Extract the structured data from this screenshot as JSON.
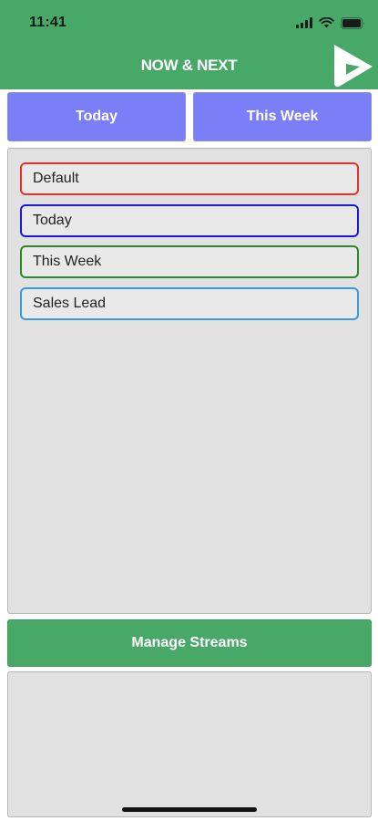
{
  "status_bar": {
    "time": "11:41"
  },
  "header": {
    "title": "NOW & NEXT",
    "logo_icon": "play-arrow-logo-icon"
  },
  "tabs": [
    {
      "label": "Today"
    },
    {
      "label": "This Week"
    }
  ],
  "streams": [
    {
      "label": "Default",
      "border_color": "#e8312b"
    },
    {
      "label": "Today",
      "border_color": "#1a1ad8"
    },
    {
      "label": "This Week",
      "border_color": "#2a8a2a"
    },
    {
      "label": "Sales Lead",
      "border_color": "#3a9ae0"
    }
  ],
  "manage_button": {
    "label": "Manage Streams"
  },
  "colors": {
    "header_green": "#48a868",
    "tab_purple": "#7b7ff7",
    "panel_gray": "#e1e1e1"
  }
}
